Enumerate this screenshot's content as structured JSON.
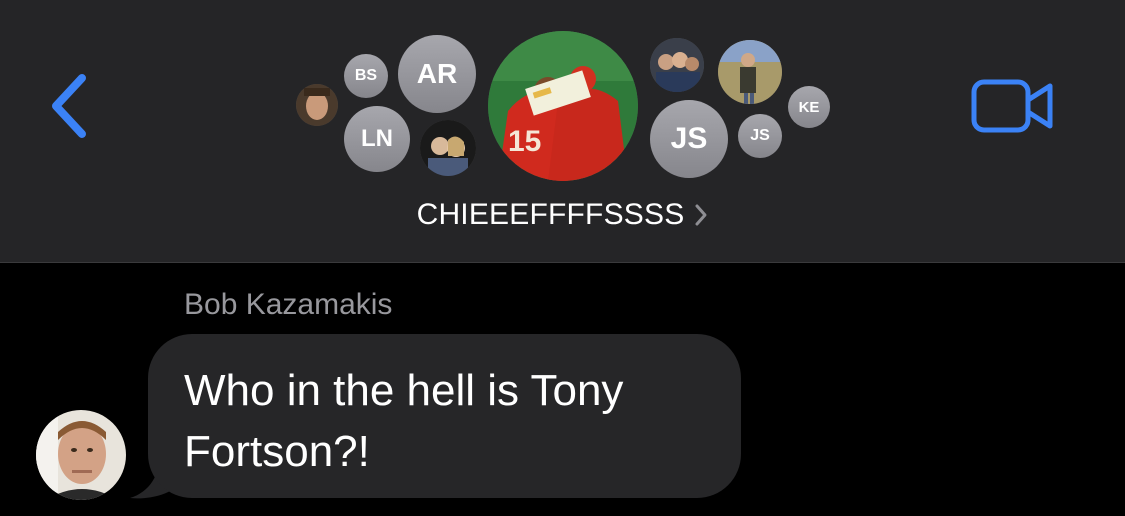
{
  "header": {
    "back_icon": "chevron-left-icon",
    "video_icon": "video-camera-icon",
    "accent_color": "#3b82f6",
    "group_name": "CHIEEEFFFFSSSS",
    "avatars": {
      "bs": "BS",
      "ar": "AR",
      "ln": "LN",
      "js_large": "JS",
      "js_small": "JS",
      "ke": "KE"
    }
  },
  "conversation": {
    "sender_name": "Bob Kazamakis",
    "message_line1": "Who in the hell is Tony",
    "message_line2": "Fortson?!",
    "bubble_color": "#262628"
  }
}
